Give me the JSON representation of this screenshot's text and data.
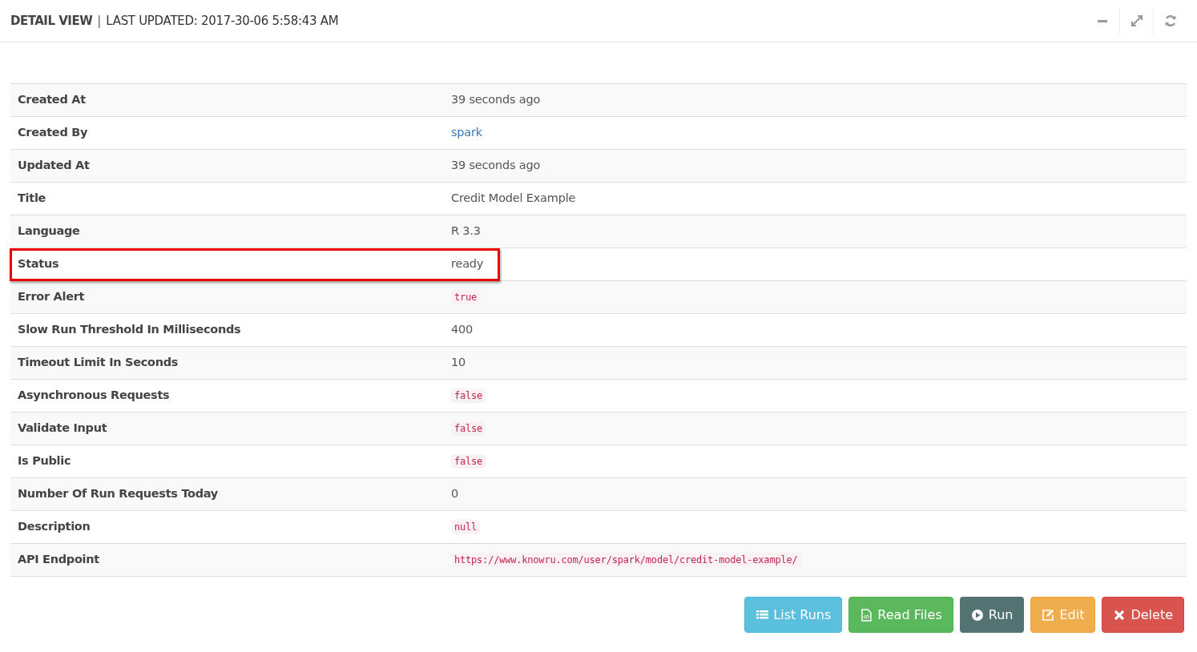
{
  "header": {
    "title": "DETAIL VIEW",
    "separator": "|",
    "subtitle": "LAST UPDATED: 2017-30-06 5:58:43 AM"
  },
  "tools": [
    {
      "kind": "minimize"
    },
    {
      "kind": "expand"
    },
    {
      "kind": "refresh"
    }
  ],
  "rows": [
    {
      "label": "Created At",
      "value": "39 seconds ago",
      "kind": "text",
      "highlighted": false
    },
    {
      "label": "Created By",
      "value": "spark",
      "kind": "link",
      "highlighted": false
    },
    {
      "label": "Updated At",
      "value": "39 seconds ago",
      "kind": "text",
      "highlighted": false
    },
    {
      "label": "Title",
      "value": "Credit Model Example",
      "kind": "text",
      "highlighted": false
    },
    {
      "label": "Language",
      "value": "R 3.3",
      "kind": "text",
      "highlighted": false
    },
    {
      "label": "Status",
      "value": "ready",
      "kind": "text",
      "highlighted": true
    },
    {
      "label": "Error Alert",
      "value": "true",
      "kind": "code",
      "highlighted": false
    },
    {
      "label": "Slow Run Threshold In Milliseconds",
      "value": "400",
      "kind": "text",
      "highlighted": false
    },
    {
      "label": "Timeout Limit In Seconds",
      "value": "10",
      "kind": "text",
      "highlighted": false
    },
    {
      "label": "Asynchronous Requests",
      "value": "false",
      "kind": "code",
      "highlighted": false
    },
    {
      "label": "Validate Input",
      "value": "false",
      "kind": "code",
      "highlighted": false
    },
    {
      "label": "Is Public",
      "value": "false",
      "kind": "code",
      "highlighted": false
    },
    {
      "label": "Number Of Run Requests Today",
      "value": "0",
      "kind": "text",
      "highlighted": false
    },
    {
      "label": "Description",
      "value": "null",
      "kind": "code",
      "highlighted": false
    },
    {
      "label": "API Endpoint",
      "value": "https://www.knowru.com/user/spark/model/credit-model-example/",
      "kind": "code",
      "highlighted": false
    }
  ],
  "buttons": [
    {
      "label": "List Runs",
      "kind": "list"
    },
    {
      "label": "Read Files",
      "kind": "files"
    },
    {
      "label": "Run",
      "kind": "run"
    },
    {
      "label": "Edit",
      "kind": "edit"
    },
    {
      "label": "Delete",
      "kind": "delete"
    }
  ]
}
